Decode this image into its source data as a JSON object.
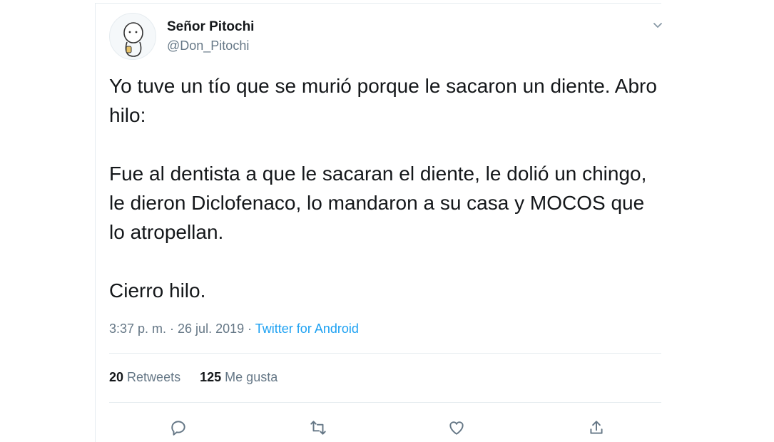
{
  "tweet": {
    "author_name": "Señor Pitochi",
    "author_handle": "@Don_Pitochi",
    "paragraphs": [
      "Yo tuve un tío que se murió porque le sacaron un diente. Abro hilo:",
      "Fue al dentista a que le sacaran el diente, le dolió un chingo, le dieron Diclofenaco, lo mandaron a su casa y MOCOS que lo atropellan.",
      "Cierro hilo."
    ],
    "timestamp": "3:37 p. m. · 26 jul. 2019",
    "separator": " · ",
    "source": "Twitter for Android"
  },
  "stats": {
    "retweets_count": "20",
    "retweets_label": "Retweets",
    "likes_count": "125",
    "likes_label": "Me gusta"
  },
  "actions": {
    "reply_icon": "reply-icon",
    "retweet_icon": "retweet-icon",
    "like_icon": "heart-icon",
    "share_icon": "share-icon"
  },
  "colors": {
    "text": "#14171a",
    "secondary": "#657786",
    "link": "#1da1f2",
    "divider": "#e6ecf0"
  }
}
